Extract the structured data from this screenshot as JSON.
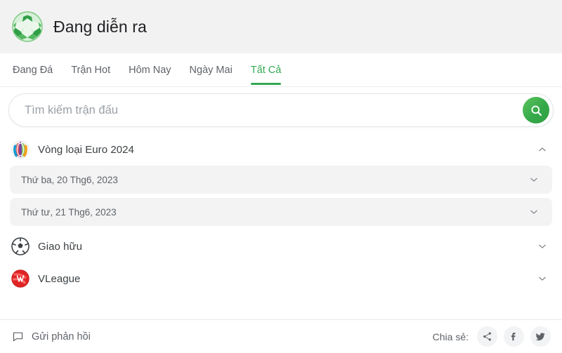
{
  "header": {
    "title": "Đang diễn ra",
    "icon": "soccer-ball-icon"
  },
  "tabs": [
    {
      "label": "Đang Đá",
      "active": false
    },
    {
      "label": "Trận Hot",
      "active": false
    },
    {
      "label": "Hôm Nay",
      "active": false
    },
    {
      "label": "Ngày Mai",
      "active": false
    },
    {
      "label": "Tất Cả",
      "active": true
    }
  ],
  "search": {
    "placeholder": "Tìm kiếm trận đấu",
    "value": "",
    "button_icon": "search-icon"
  },
  "leagues": [
    {
      "name": "Vòng loại Euro 2024",
      "logo": "euro-2024-logo",
      "expanded": true,
      "chevron": "chevron-up-icon",
      "dates": [
        {
          "label": "Thứ ba, 20 Thg6, 2023",
          "chevron": "chevron-down-icon"
        },
        {
          "label": "Thứ tư, 21 Thg6, 2023",
          "chevron": "chevron-down-icon"
        }
      ]
    },
    {
      "name": "Giao hữu",
      "logo": "friendly-match-logo",
      "expanded": false,
      "chevron": "chevron-down-icon",
      "dates": []
    },
    {
      "name": "VLeague",
      "logo": "vleague-logo",
      "expanded": false,
      "chevron": "chevron-down-icon",
      "dates": []
    }
  ],
  "footer": {
    "feedback_label": "Gửi phản hồi",
    "feedback_icon": "comment-icon",
    "share_label": "Chia sẻ:",
    "share_buttons": [
      {
        "name": "share-icon"
      },
      {
        "name": "facebook-icon"
      },
      {
        "name": "twitter-icon"
      }
    ]
  },
  "colors": {
    "accent_green": "#34a853",
    "header_bg": "#f2f2f2",
    "text_primary": "#3c4043",
    "text_secondary": "#5f6368",
    "row_bg": "#f3f3f4",
    "vleague_red": "#e02424"
  }
}
